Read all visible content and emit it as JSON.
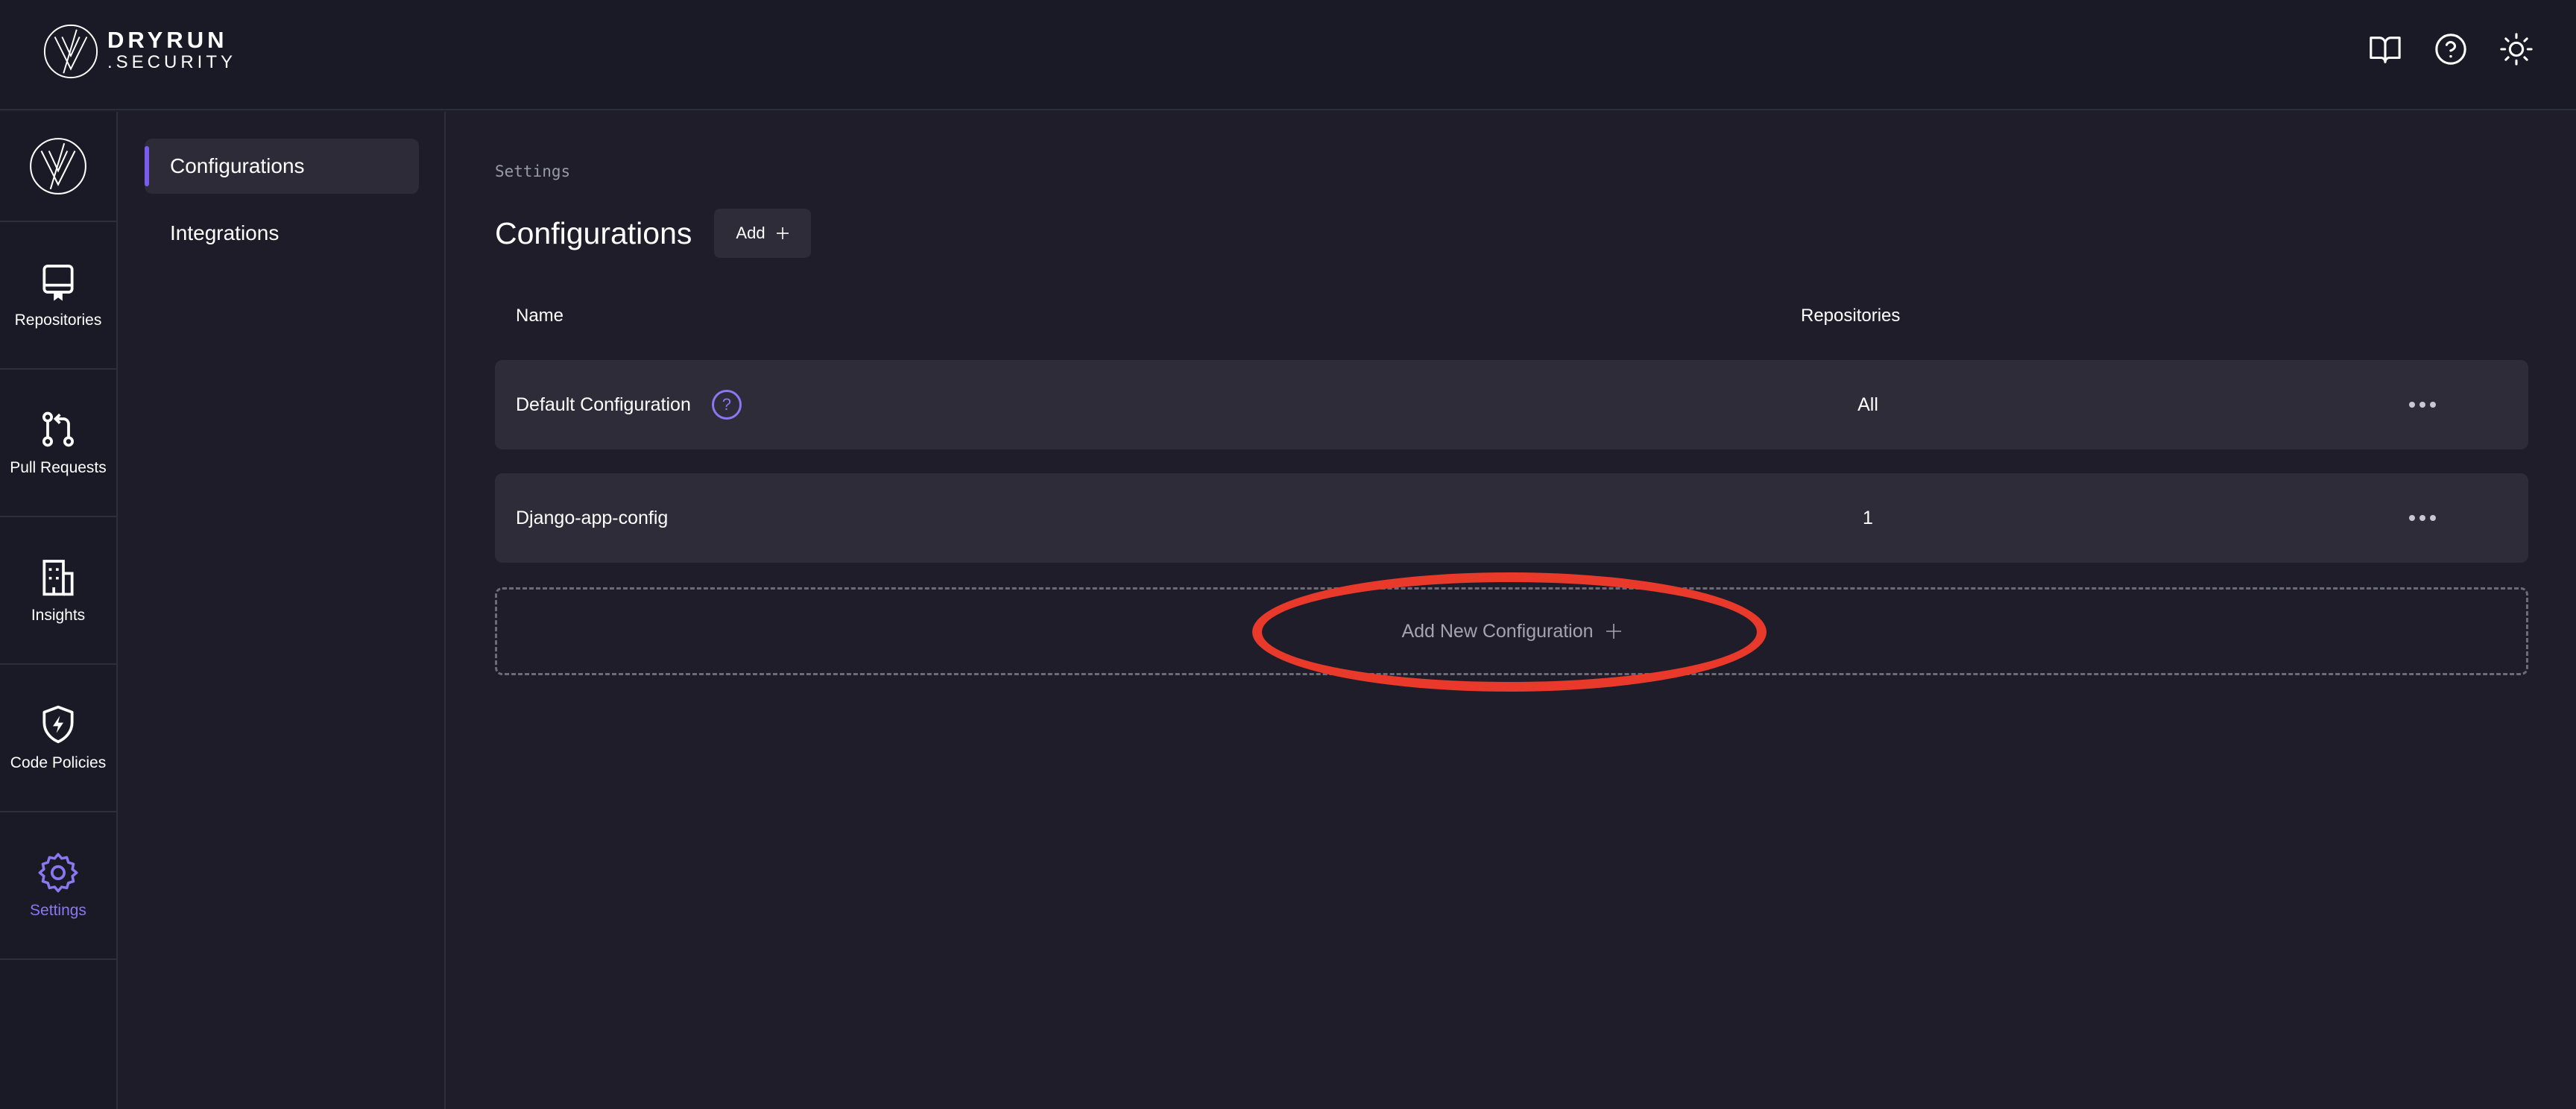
{
  "brand": {
    "line1": "DRYRUN",
    "line2": ".SECURITY"
  },
  "topbar": {
    "icons": [
      "book-icon",
      "help-circle-icon",
      "sun-icon"
    ]
  },
  "rail": {
    "items": [
      {
        "label": "Repositories",
        "icon": "repository-icon"
      },
      {
        "label": "Pull Requests",
        "icon": "pull-request-icon"
      },
      {
        "label": "Insights",
        "icon": "building-icon"
      },
      {
        "label": "Code Policies",
        "icon": "shield-bolt-icon"
      },
      {
        "label": "Settings",
        "icon": "gear-icon",
        "active": true
      }
    ]
  },
  "subnav": {
    "items": [
      {
        "label": "Configurations",
        "active": true
      },
      {
        "label": "Integrations"
      }
    ]
  },
  "main": {
    "breadcrumb": "Settings",
    "title": "Configurations",
    "add_label": "Add",
    "columns": {
      "name": "Name",
      "repositories": "Repositories"
    },
    "rows": [
      {
        "name": "Default Configuration",
        "repositories": "All",
        "has_help": true
      },
      {
        "name": "Django-app-config",
        "repositories": "1",
        "has_help": false
      }
    ],
    "add_new_label": "Add New Configuration"
  },
  "colors": {
    "accent": "#8b77f0",
    "annotation": "#e8392a",
    "background": "#1e1d29"
  }
}
